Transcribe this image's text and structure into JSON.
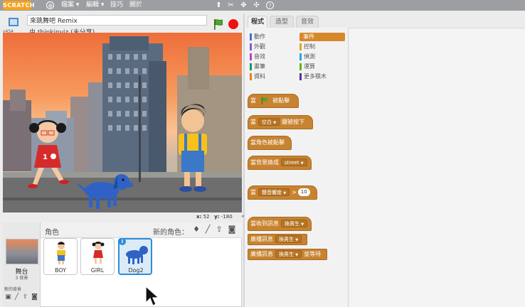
{
  "menubar": {
    "logo": "SCRATCH",
    "items": [
      "檔案",
      "編輯",
      "技巧",
      "關於"
    ]
  },
  "project": {
    "title": "來跳舞吧 Remix",
    "author": "由 thinkinviz (未分享)",
    "version": "v454"
  },
  "stage": {
    "x_label": "x:",
    "x_value": "52",
    "y_label": "y:",
    "y_value": "-180"
  },
  "sprites": {
    "header": "角色",
    "new_sprite_label": "新的角色：",
    "stage_name": "舞台",
    "stage_count": "3 背景",
    "new_bg_label": "新的背景",
    "items": [
      {
        "name": "BOY",
        "selected": false
      },
      {
        "name": "GIRL",
        "selected": false
      },
      {
        "name": "Dog2",
        "selected": true
      }
    ],
    "info_icon": "i"
  },
  "tabs": [
    "程式",
    "造型",
    "音效"
  ],
  "categories": [
    {
      "label": "動作",
      "color": "#4a6cd4"
    },
    {
      "label": "事件",
      "color": "#c88330",
      "active": true
    },
    {
      "label": "外觀",
      "color": "#8a55d7"
    },
    {
      "label": "控制",
      "color": "#e1a91a"
    },
    {
      "label": "音效",
      "color": "#bb42c3"
    },
    {
      "label": "偵測",
      "color": "#2ca5e2"
    },
    {
      "label": "畫筆",
      "color": "#0e9a6c"
    },
    {
      "label": "運算",
      "color": "#5cb712"
    },
    {
      "label": "資料",
      "color": "#ee7d16"
    },
    {
      "label": "更多積木",
      "color": "#632d99"
    }
  ],
  "blocks": {
    "when_flag": {
      "pre": "當",
      "post": "被點擊"
    },
    "when_key": {
      "pre": "當",
      "key": "空白",
      "post": "鍵被按下"
    },
    "when_sprite_clicked": "當角色被點擊",
    "when_backdrop": {
      "text": "當背景換成",
      "value": "street"
    },
    "when_sound": {
      "pre": "當",
      "sensor": "聲音響度",
      "op": ">",
      "value": "10"
    },
    "when_receive": {
      "text": "當收到訊息",
      "value": "換男生"
    },
    "broadcast": {
      "text": "廣播訊息",
      "value": "換男生"
    },
    "broadcast_wait": {
      "text": "廣播訊息",
      "value": "換男生",
      "post": "並等待"
    }
  }
}
